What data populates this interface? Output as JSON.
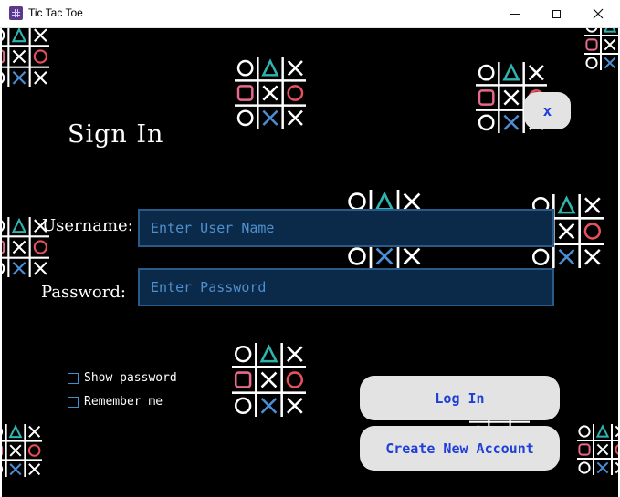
{
  "window": {
    "title": "Tic Tac Toe",
    "icon": "tic-tac-toe-app-icon",
    "controls": [
      "minimize-icon",
      "maximize-icon",
      "close-icon"
    ]
  },
  "form": {
    "heading": "Sign In",
    "close_label": "x",
    "username_label": "Username:",
    "username_placeholder": "Enter User Name",
    "username_value": "",
    "password_label": "Password:",
    "password_placeholder": "Enter Password",
    "password_value": "",
    "show_password_label": "Show password",
    "show_password_checked": false,
    "remember_me_label": "Remember me",
    "remember_me_checked": false,
    "login_label": "Log In",
    "create_account_label": "Create New Account"
  },
  "colors": {
    "background": "#000000",
    "input_fill": "#0b2a4a",
    "input_border": "#2a5a87",
    "placeholder": "#4f8fcb",
    "button_fill": "#e3e3e3",
    "button_text": "#1f3fd8",
    "board_o_red": "#e8505b",
    "board_o_white": "#ffffff",
    "board_triangle": "#2fb5b0",
    "board_square": "#e86a8a",
    "board_x_blue": "#4a8fd8"
  }
}
